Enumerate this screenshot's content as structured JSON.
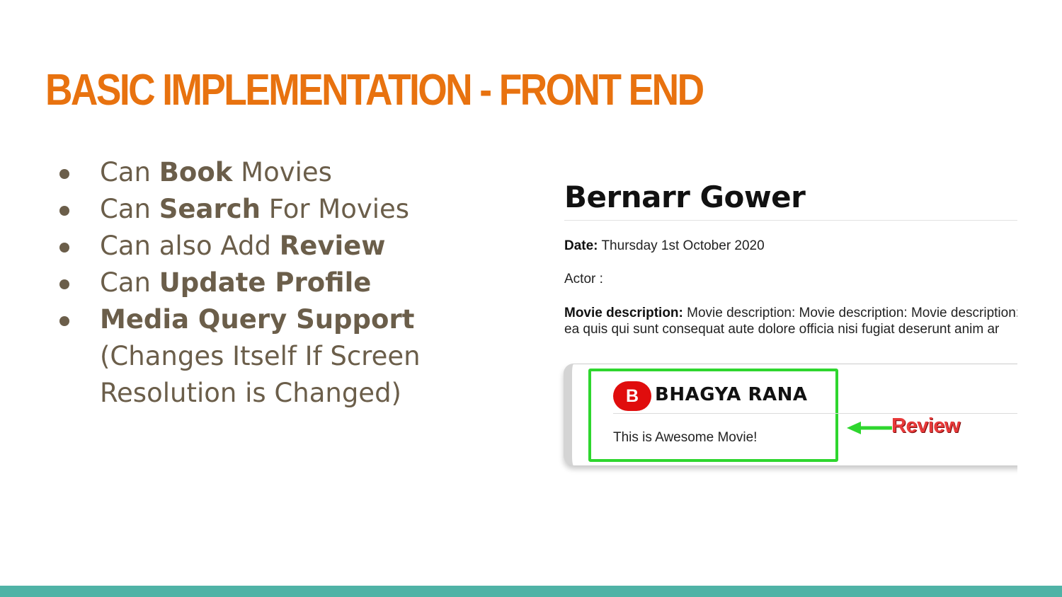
{
  "slide": {
    "title": "BASIC IMPLEMENTATION - FRONT END",
    "bullets": [
      {
        "pre": "Can ",
        "bold": "Book",
        "post": " Movies"
      },
      {
        "pre": "Can ",
        "bold": "Search",
        "post": " For Movies"
      },
      {
        "pre": "Can also Add ",
        "bold": "Review",
        "post": ""
      },
      {
        "pre": "Can ",
        "bold": "Update Profile",
        "post": ""
      },
      {
        "pre": "",
        "bold": "Media Query Support",
        "post": " (Changes Itself If Screen Resolution is Changed)"
      }
    ]
  },
  "screenshot": {
    "movie_title": "Bernarr Gower",
    "date_label": "Date:",
    "date_value": " Thursday 1st October 2020",
    "actor_label": "Actor :",
    "description_label": "Movie description:",
    "description_line1": " Movie description: Movie description: Movie description:",
    "description_line2": "ea quis qui sunt consequat aute dolore officia nisi fugiat deserunt anim ar",
    "review": {
      "avatar_letter": "B",
      "reviewer_name": "BHAGYA RANA",
      "text": "This is Awesome Movie!",
      "annotation_label": "Review"
    }
  },
  "colors": {
    "title": "#e8720f",
    "body_text": "#6b5e4a",
    "highlight_box": "#2ed62e",
    "avatar": "#e00d0d",
    "annotation": "#e83a3a",
    "footer_bar": "#4fb3a6"
  }
}
